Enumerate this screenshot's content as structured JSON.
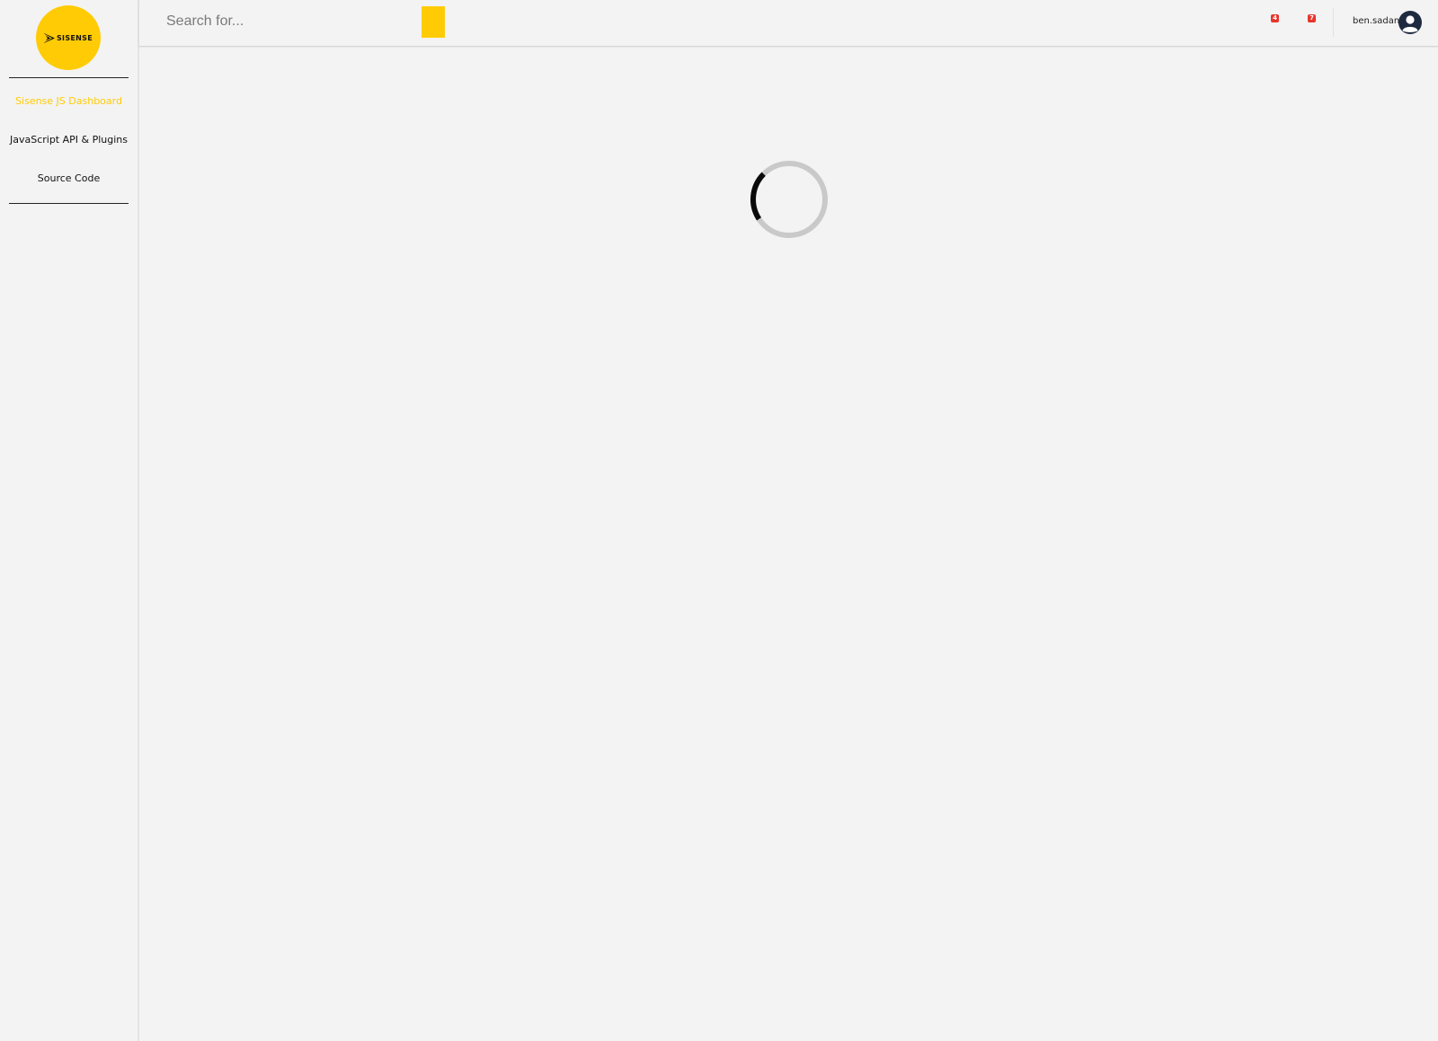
{
  "brand": {
    "logo_text": "SISENSE",
    "accent_color": "#ffcb05"
  },
  "sidebar": {
    "items": [
      {
        "label": "Sisense JS Dashboard",
        "active": true
      },
      {
        "label": "JavaScript API & Plugins",
        "active": false
      },
      {
        "label": "Source Code",
        "active": false
      }
    ]
  },
  "header": {
    "search": {
      "placeholder": "Search for..."
    },
    "badges": [
      {
        "icon": "notification-icon",
        "count": "4"
      },
      {
        "icon": "alert-icon",
        "count": "7"
      }
    ],
    "user": {
      "name": "ben.sadan",
      "icon": "user-avatar-icon"
    }
  },
  "main": {
    "state": "loading",
    "spinner_icon": "loading-spinner-icon"
  }
}
